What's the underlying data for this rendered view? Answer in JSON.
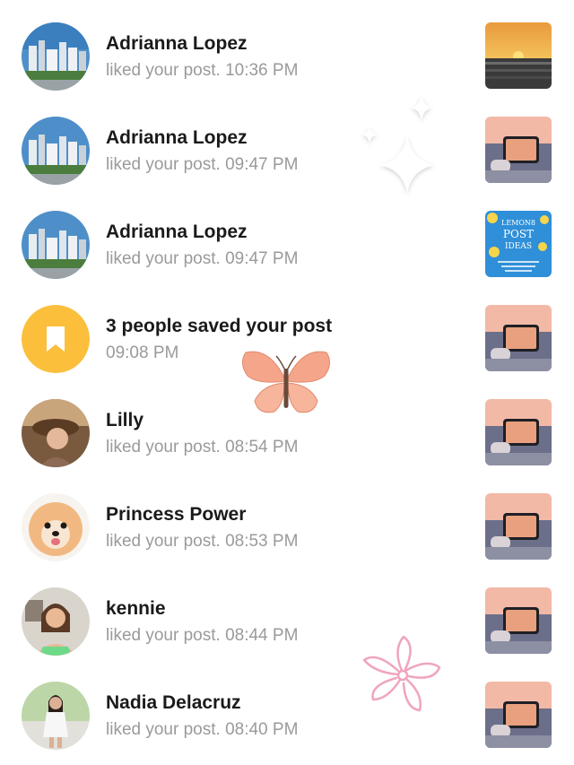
{
  "notifications": [
    {
      "title": "Adrianna Lopez",
      "subtitle": "liked your post. 10:36 PM",
      "avatar": "city-skyline-avatar",
      "thumbnail": "sunset-thumbnail"
    },
    {
      "title": "Adrianna Lopez",
      "subtitle": "liked your post. 09:47 PM",
      "avatar": "city-skyline-avatar",
      "thumbnail": "phone-beach-thumbnail"
    },
    {
      "title": "Adrianna Lopez",
      "subtitle": "liked your post. 09:47 PM",
      "avatar": "city-skyline-avatar",
      "thumbnail": "lemon-post-ideas-thumbnail",
      "thumbnail_text": [
        "LEMON8",
        "POST",
        "IDEAS"
      ]
    },
    {
      "title": "3 people saved your post",
      "subtitle": "09:08 PM",
      "avatar": "bookmark-icon",
      "thumbnail": "phone-beach-thumbnail"
    },
    {
      "title": "Lilly",
      "subtitle": "liked your post. 08:54 PM",
      "avatar": "user-photo-avatar",
      "thumbnail": "phone-beach-thumbnail"
    },
    {
      "title": "Princess Power",
      "subtitle": "liked your post. 08:53 PM",
      "avatar": "dog-avatar",
      "thumbnail": "phone-beach-thumbnail"
    },
    {
      "title": "kennie",
      "subtitle": "liked your post. 08:44 PM",
      "avatar": "user-photo-avatar",
      "thumbnail": "phone-beach-thumbnail"
    },
    {
      "title": "Nadia Delacruz",
      "subtitle": "liked your post. 08:40 PM",
      "avatar": "user-photo-avatar",
      "thumbnail": "phone-beach-thumbnail"
    }
  ],
  "decorations": [
    "sparkle-icon",
    "butterfly-icon",
    "flower-doodle-icon"
  ],
  "colors": {
    "title": "#1a1a1a",
    "subtitle": "#9a9a9a",
    "bookmark_bg": "#fbbf3c",
    "butterfly": "#f5a58a",
    "flower": "#f0a5bd"
  }
}
